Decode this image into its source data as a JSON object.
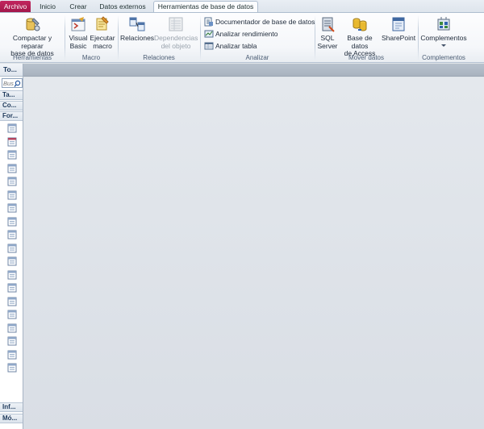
{
  "tabs": [
    {
      "label": "Archivo"
    },
    {
      "label": "Inicio"
    },
    {
      "label": "Crear"
    },
    {
      "label": "Datos externos"
    },
    {
      "label": "Herramientas de base de datos"
    }
  ],
  "ribbon": {
    "herramientas": {
      "label": "Herramientas",
      "compactar_line1": "Compactar y reparar",
      "compactar_line2": "base de datos"
    },
    "macro": {
      "label": "Macro",
      "vb_line1": "Visual",
      "vb_line2": "Basic",
      "ejecutar_line1": "Ejecutar",
      "ejecutar_line2": "macro"
    },
    "relaciones": {
      "label": "Relaciones",
      "relaciones_btn": "Relaciones",
      "dependencias_line1": "Dependencias",
      "dependencias_line2": "del objeto"
    },
    "analizar": {
      "label": "Analizar",
      "documentador": "Documentador de base de datos",
      "rendimiento": "Analizar rendimiento",
      "tabla": "Analizar tabla"
    },
    "mover": {
      "label": "Mover datos",
      "sql_line1": "SQL",
      "sql_line2": "Server",
      "access_line1": "Base de datos",
      "access_line2": "de Access",
      "sharepoint": "SharePoint"
    },
    "complementos": {
      "label": "Complementos",
      "btn": "Complementos"
    }
  },
  "nav": {
    "header": "To...",
    "search_placeholder": "Bus",
    "categories_top": [
      "Ta...",
      "Co...",
      "For..."
    ],
    "categories_bottom": [
      "Inf...",
      "Mó..."
    ],
    "form_item_count": 19
  }
}
